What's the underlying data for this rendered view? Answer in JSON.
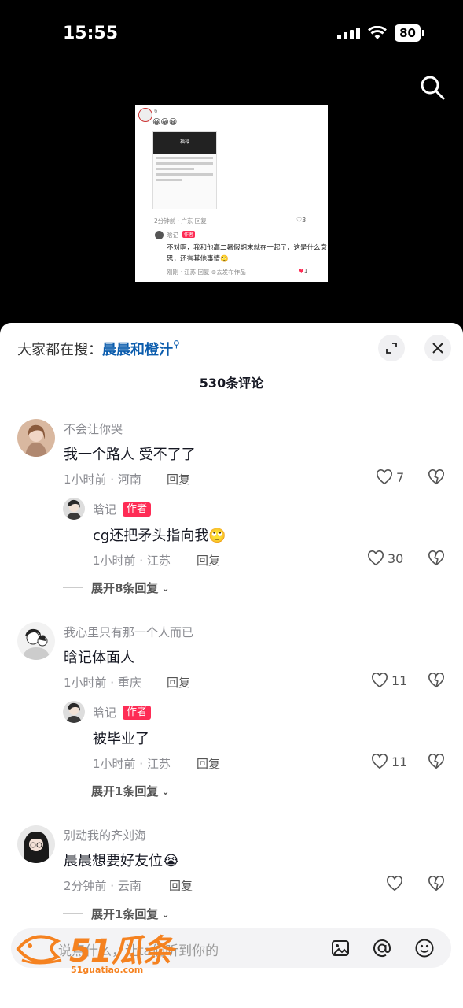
{
  "status": {
    "time": "15:55",
    "battery": "80"
  },
  "video_frame": {
    "count": "6",
    "emojis": "😀😀😀",
    "inner_title": "福禄",
    "meta": "2分钟前 · 广东   回复",
    "likes": "♡3",
    "reply_name": "晗记",
    "reply_badge": "作者",
    "reply_text": "不对啊，我和他高二暑假期末就在一起了，这是什么意思，还有其他事情🙄",
    "reply_meta": "刚刚 · 江苏   回复   ⊕去发布作品",
    "reply_likes": "1"
  },
  "sheet": {
    "trend_prefix": "大家都在搜：",
    "trend_keyword": "晨晨和橙汁",
    "comment_count": "530条评论"
  },
  "comments": [
    {
      "name": "不会让你哭",
      "text": "我一个路人 受不了了",
      "meta": "1小时前 · 河南",
      "reply": "回复",
      "likes": "7",
      "sub": {
        "name": "晗记",
        "badge": "作者",
        "text": "cg还把矛头指向我🙄",
        "meta": "1小时前 · 江苏",
        "reply": "回复",
        "likes": "30"
      },
      "expand": "展开8条回复"
    },
    {
      "name": "我心里只有那一个人而已",
      "text": "晗记体面人",
      "meta": "1小时前 · 重庆",
      "reply": "回复",
      "likes": "11",
      "sub": {
        "name": "晗记",
        "badge": "作者",
        "text": "被毕业了",
        "meta": "1小时前 · 江苏",
        "reply": "回复",
        "likes": "11"
      },
      "expand": "展开1条回复"
    },
    {
      "name": "别动我的齐刘海",
      "text": "晨晨想要好友位😭",
      "meta": "2分钟前 · 云南",
      "reply": "回复",
      "likes": "",
      "expand": "展开1条回复"
    }
  ],
  "input": {
    "placeholder": "说点什么，让ta们听到你的"
  },
  "watermark": {
    "main": "51瓜条",
    "sub": "51guatiao.com"
  }
}
